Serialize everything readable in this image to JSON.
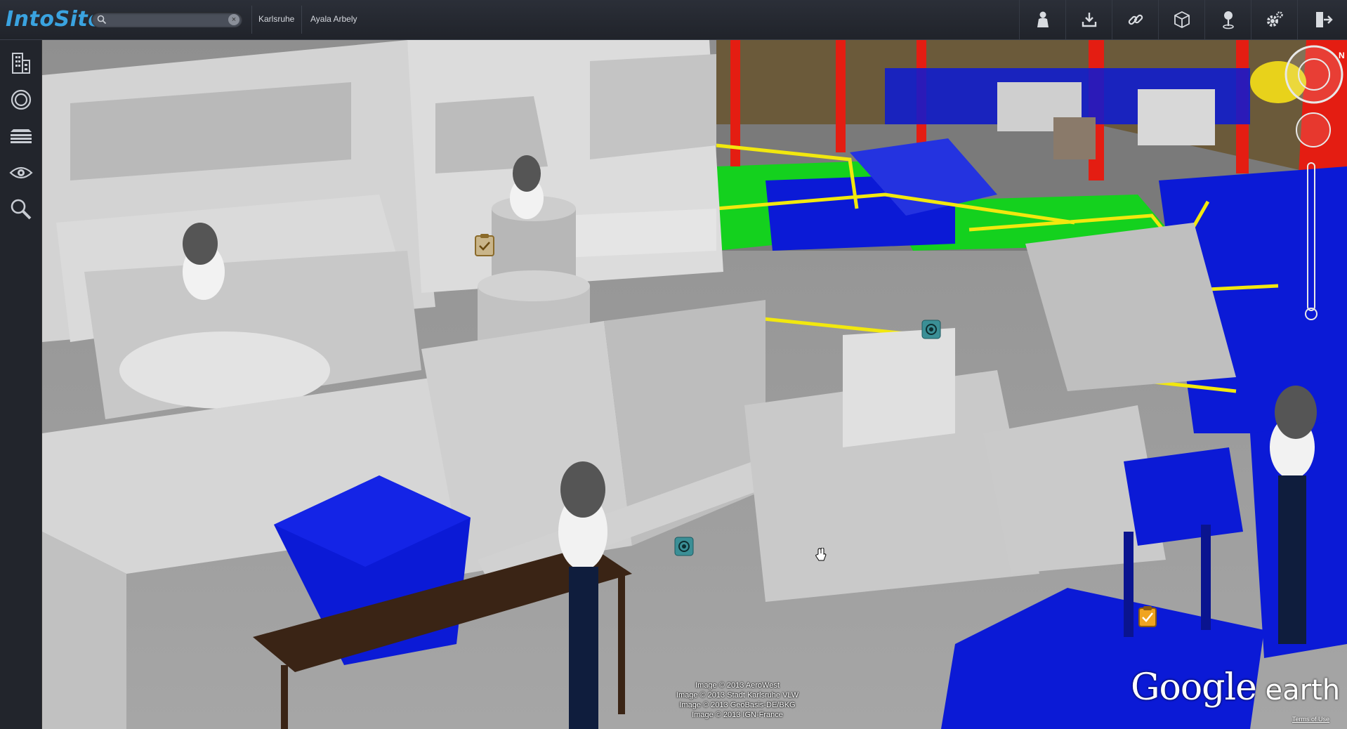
{
  "app": {
    "logo": "IntoSite"
  },
  "search": {
    "value": "",
    "placeholder": "",
    "clear_label": "×"
  },
  "breadcrumb": {
    "site": "Karlsruhe",
    "user": "Ayala Arbely"
  },
  "toolbar": {
    "icons": [
      "person-icon",
      "download-icon",
      "link-icon",
      "cube-icon",
      "pin-icon",
      "gear-icon",
      "exit-icon"
    ]
  },
  "sidebar": {
    "icons": [
      "building-icon",
      "circle-icon",
      "layers-icon",
      "eye-icon",
      "search-icon"
    ]
  },
  "viewer": {
    "credits": [
      "Image © 2013 AeroWest",
      "Image © 2013 Stadt Karlsruhe VLW",
      "Image © 2013 GeoBasis-DE/BKG",
      "Image © 2013 IGN-France"
    ],
    "brand_main": "Google",
    "brand_sub": " earth",
    "terms": "Terms of Use",
    "compass_label": "N"
  },
  "colors": {
    "accent": "#3aa3e0",
    "blue": "#0b1ad6",
    "yellow": "#f2e80e",
    "green": "#14d11e",
    "red": "#e41d12",
    "machine": "#d3d3d3"
  }
}
